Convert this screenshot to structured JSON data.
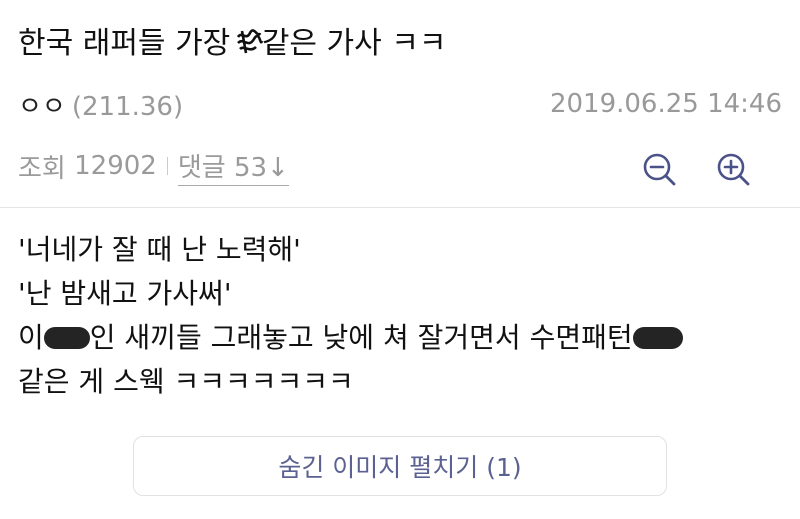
{
  "post": {
    "title_before": "한국 래퍼들 가장 ",
    "title_after": "같은 가사 ㅋㅋ",
    "author": "ㅇㅇ",
    "ip": "(211.36)",
    "datetime": "2019.06.25 14:46",
    "views_label": "조회",
    "views": "12902",
    "comments_label": "댓글",
    "comments_count": "53",
    "comments_arrow": "↓"
  },
  "content": {
    "line1": "'너네가 잘 때 난 노력해'",
    "line2": "'난 밤새고 가사써'",
    "line3_a": "이",
    "line3_b": "인 새끼들 그래놓고 낮에 쳐 잘거면서 수면패턴",
    "line4": "같은 게 스웩 ㅋㅋㅋㅋㅋㅋㅋ"
  },
  "actions": {
    "show_hidden_images": "숨긴 이미지 펼치기 (1)"
  },
  "icons": {
    "zoom_out": "zoom-out-icon",
    "zoom_in": "zoom-in-icon"
  },
  "colors": {
    "accent": "#4a5288",
    "muted": "#999999"
  }
}
